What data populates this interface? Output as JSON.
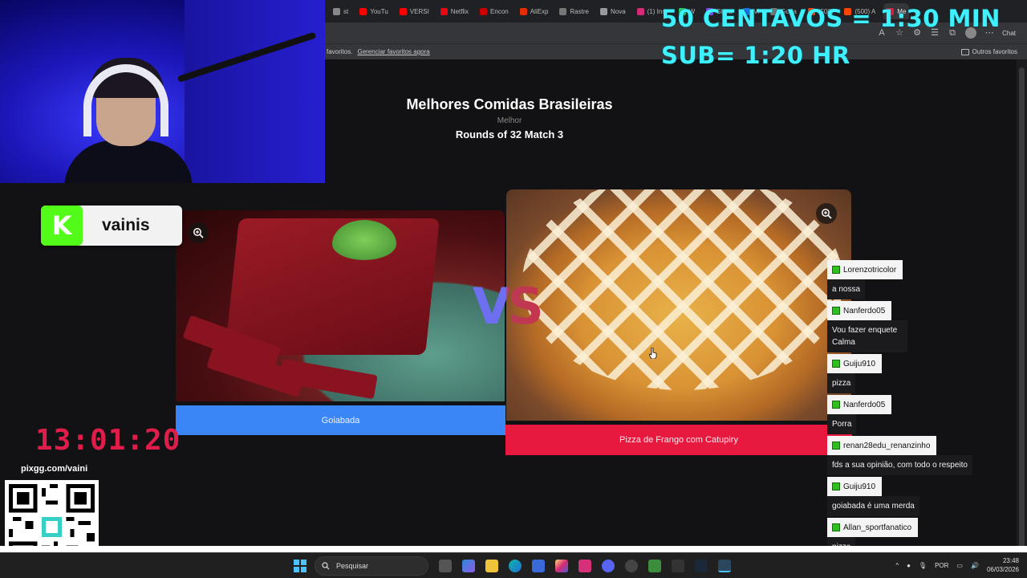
{
  "browser": {
    "tabs": [
      {
        "label": "st",
        "color": "#888888"
      },
      {
        "label": "YouTu",
        "color": "#ff0000"
      },
      {
        "label": "VERSI",
        "color": "#ff0000"
      },
      {
        "label": "Netflix",
        "color": "#e50914"
      },
      {
        "label": "Encon",
        "color": "#cc0000"
      },
      {
        "label": "AliExp",
        "color": "#e62e04"
      },
      {
        "label": "Rastre",
        "color": "#777777"
      },
      {
        "label": "Nova",
        "color": "#999999"
      },
      {
        "label": "(1) Inst",
        "color": "#d62976"
      },
      {
        "label": "W",
        "color": "#25d366"
      },
      {
        "label": "Strea",
        "color": "#9147ff"
      },
      {
        "label": "Vi",
        "color": "#1a73e8"
      },
      {
        "label": "Goda",
        "color": "#777777"
      },
      {
        "label": "(500)",
        "color": "#ff4500"
      },
      {
        "label": "(500) A",
        "color": "#ff4500"
      },
      {
        "label": "Me",
        "color": "#e8193e"
      }
    ],
    "chat_button": "Chat",
    "bookmarks_text": "favoritos.",
    "bookmarks_link": "Gerenciar favoritos agora",
    "other_favorites": "Outros favoritos"
  },
  "overlay": {
    "line1": "50 CENTAVOS = 1:30 MIN",
    "line2": "SUB= 1:20 HR"
  },
  "page": {
    "title": "Melhores Comidas Brasileiras",
    "subtitle": "Melhor",
    "round": "Rounds of 32 Match 3",
    "vs": "VS",
    "left_option": "Goiabada",
    "right_option": "Pizza de Frango com Catupiry"
  },
  "streamer": {
    "kick_letter": "K",
    "name": "vainis",
    "timer": "13:01:20",
    "pix": "pixgg.com/vaini"
  },
  "chat": [
    {
      "user": "Lorenzotricolor",
      "text": "a nossa"
    },
    {
      "user": "Nanferdo05",
      "text": "Vou fazer enquete Calma"
    },
    {
      "user": "Guiju910",
      "text": "pizza"
    },
    {
      "user": "Nanferdo05",
      "text": "Porra"
    },
    {
      "user": "renan28edu_renanzinho",
      "text": "fds a sua opinião, com todo o respeito"
    },
    {
      "user": "Guiju910",
      "text": "goiabada é uma merda"
    },
    {
      "user": "Allan_sportfanatico",
      "text": "pizza"
    }
  ],
  "taskbar": {
    "search_placeholder": "Pesquisar",
    "language": "POR",
    "time": "23:48",
    "date": "06/03/2026"
  },
  "colors": {
    "accent_cyan": "#3ff0ff",
    "left_button": "#3b86f7",
    "right_button": "#e8193e",
    "timer": "#e01d4a",
    "kick_green": "#53fc18"
  }
}
